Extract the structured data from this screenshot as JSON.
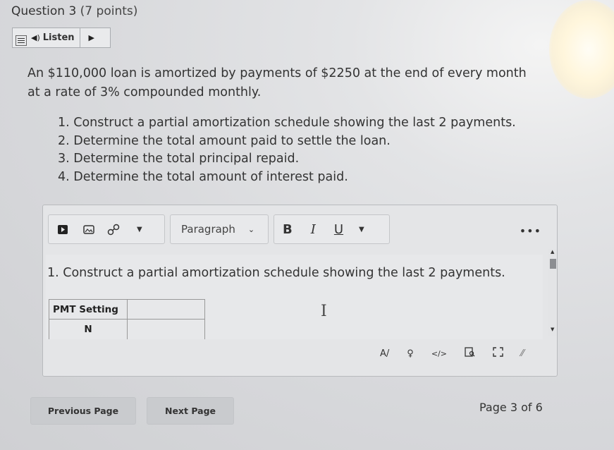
{
  "question": {
    "title": "Question 3",
    "points": "(7 points)"
  },
  "listen": {
    "label": "Listen",
    "icons": [
      "menu-icon",
      "speaker-icon",
      "play-icon"
    ]
  },
  "problem_text": "An $110,000 loan is amortized by payments of $2250 at the end of every month at a rate of 3% compounded monthly.",
  "steps": [
    "1. Construct a partial amortization schedule showing the last 2 payments.",
    "2. Determine the total amount paid to settle the loan.",
    "3. Determine the total principal repaid.",
    "4. Determine the total amount of interest paid."
  ],
  "editor": {
    "toolbar": {
      "paragraph_label": "Paragraph",
      "bold": "B",
      "italic": "I",
      "underline": "U",
      "more": "•••"
    },
    "content_text": "1. Construct a partial amortization schedule showing the last 2 payments.",
    "table": {
      "header": "PMT Setting",
      "row1": "N"
    },
    "bottom_icons": [
      "spellcheck-icon",
      "accessibility-icon",
      "code-icon",
      "preview-icon",
      "fullscreen-icon",
      "resize-icon"
    ]
  },
  "nav": {
    "previous": "Previous Page",
    "next": "Next Page",
    "page_indicator": "Page 3 of 6"
  }
}
